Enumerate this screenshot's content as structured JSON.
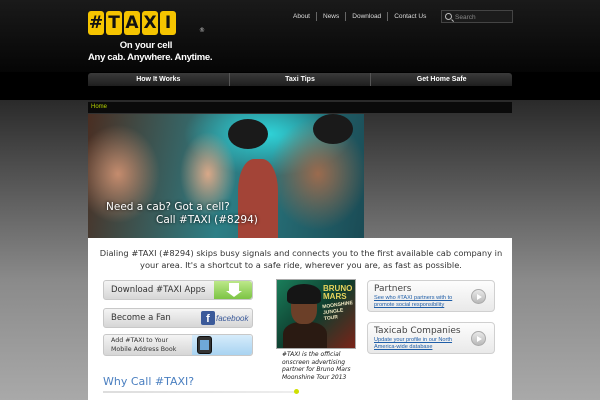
{
  "brand": {
    "logo_text": "#TAXI",
    "logo_letters": [
      "#",
      "T",
      "A",
      "X",
      "I"
    ],
    "registered": "®",
    "tagline_line1": "On your cell",
    "tagline_line2": "Any cab. Anywhere. Anytime."
  },
  "top_links": [
    "About",
    "News",
    "Download",
    "Contact Us"
  ],
  "search": {
    "placeholder": "Search"
  },
  "nav": [
    "How It Works",
    "Taxi Tips",
    "Get Home Safe"
  ],
  "breadcrumb": "Home",
  "hero": {
    "line1": "Need a cab? Got a cell?",
    "line2": "Call #TAXI (#8294)"
  },
  "intro": "Dialing #TAXI (#8294) skips busy signals and connects you to the first available cab company in your area. It's a shortcut to a safe ride, wherever you are, as fast as possible.",
  "cta": {
    "download": "Download #TAXI Apps",
    "fan": "Become a Fan",
    "facebook_f": "f",
    "facebook_text": "facebook",
    "address_line1": "Add #TAXI to Your",
    "address_line2": "Mobile Address Book"
  },
  "album": {
    "title_line1": "BRUNO",
    "title_line2": "MARS",
    "subtitle_line1": "MOONSHINE",
    "subtitle_line2": "JUNGLE TOUR",
    "caption": "#TAXI is the official onscreen advertising partner for Bruno Mars Moonshine Tour 2013"
  },
  "boxes": [
    {
      "title": "Partners",
      "link": "See who #TAXI partners with to promote social responsibility"
    },
    {
      "title": "Taxicab Companies",
      "link": "Update your profile in our North America-wide database"
    }
  ],
  "why_heading": "Why Call #TAXI?",
  "colors": {
    "logo_yellow": "#f5c400",
    "breadcrumb_green": "#b6d400",
    "link_blue": "#1f5ea8",
    "heading_blue": "#4a7fc0"
  }
}
